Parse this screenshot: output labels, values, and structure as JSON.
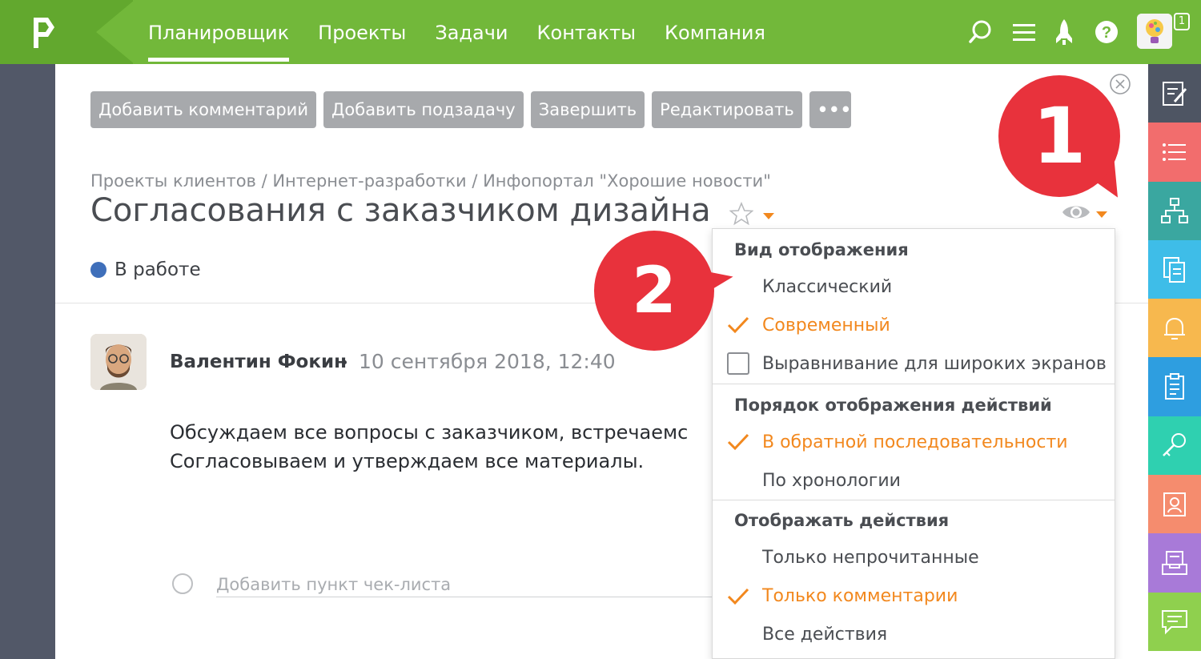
{
  "nav": {
    "items": [
      {
        "label": "Планировщик",
        "active": true
      },
      {
        "label": "Проекты",
        "active": false
      },
      {
        "label": "Задачи",
        "active": false
      },
      {
        "label": "Контакты",
        "active": false
      },
      {
        "label": "Компания",
        "active": false
      }
    ],
    "notification_count": "1"
  },
  "toolbar": {
    "add_comment": "Добавить комментарий",
    "add_subtask": "Добавить подзадачу",
    "complete": "Завершить",
    "edit": "Редактировать",
    "more": "•••"
  },
  "task": {
    "breadcrumb": "Проекты клиентов / Интернет-разработки / Инфопортал \"Хорошие новости\"",
    "title": "Согласования с заказчиком дизайна",
    "status": "В работе"
  },
  "comment": {
    "author": "Валентин Фокин",
    "date": "10 сентября 2018, 12:40",
    "line1": "Обсуждаем все вопросы с заказчиком, встречаемс",
    "line2": "Согласовываем и утверждаем все материалы."
  },
  "checklist": {
    "placeholder": "Добавить пункт чек-листа"
  },
  "dropdown": {
    "view_title": "Вид отображения",
    "view_classic": "Классический",
    "view_modern": "Современный",
    "view_wide": "Выравнивание для широких экранов",
    "order_title": "Порядок отображения действий",
    "order_reverse": "В обратной последовательности",
    "order_chrono": "По хронологии",
    "show_title": "Отображать действия",
    "show_unread": "Только непрочитанные",
    "show_comments": "Только комментарии",
    "show_all": "Все действия"
  },
  "callouts": {
    "one": "1",
    "two": "2"
  },
  "colors": {
    "header_green": "#72b83a",
    "accent_orange": "#f2881e",
    "status_blue": "#3f6fba",
    "callout_red": "#e8323c",
    "button_gray": "#a7a9ac"
  },
  "sidebar_icons": [
    "edit-note-icon",
    "list-icon",
    "hierarchy-icon",
    "documents-icon",
    "bell-icon",
    "clipboard-icon",
    "key-icon",
    "contact-card-icon",
    "inbox-icon",
    "chat-icon"
  ]
}
